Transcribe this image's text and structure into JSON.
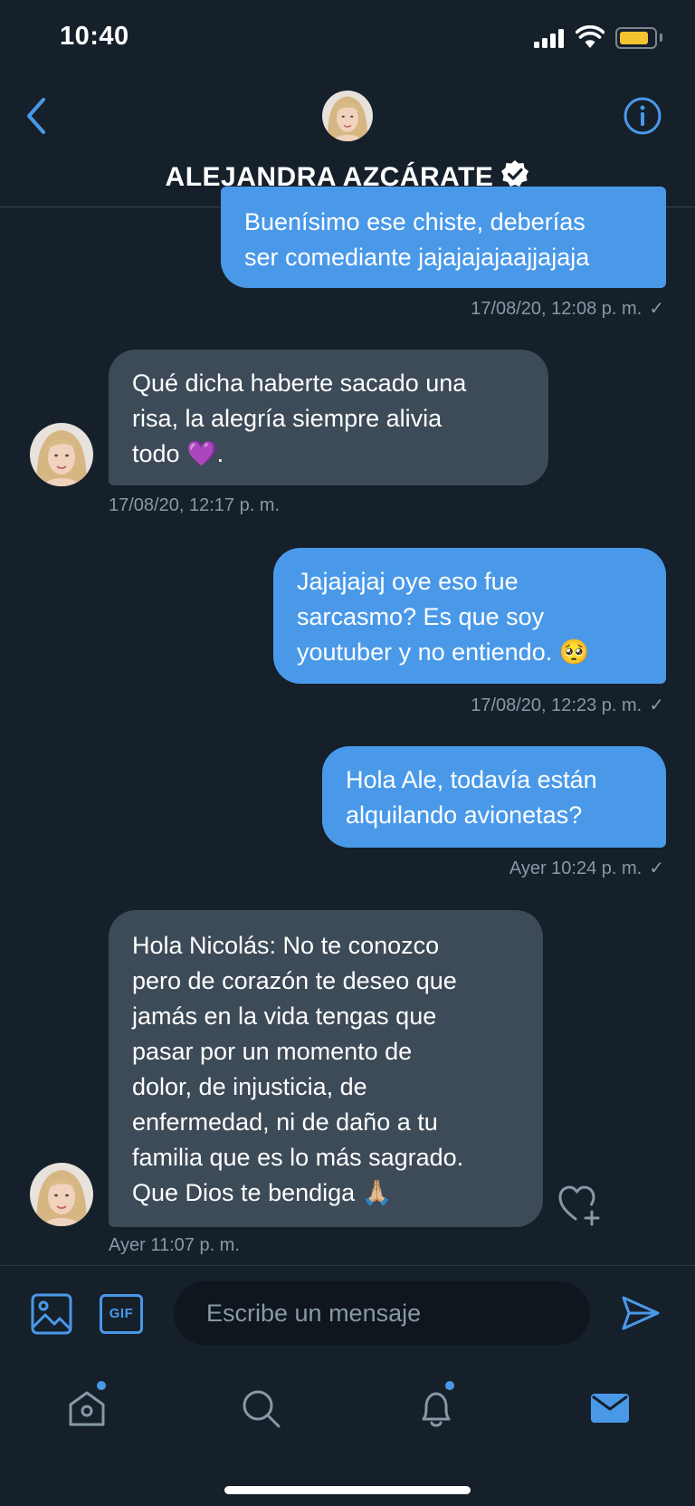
{
  "status_bar": {
    "time": "10:40"
  },
  "header": {
    "name": "ALEJANDRA AZCÁRATE"
  },
  "messages": [
    {
      "type": "sent",
      "lines": [
        "Buenísimo ese chiste, deberías",
        "ser comediante jajajajajaajjajaja"
      ],
      "time": "17/08/20, 12:08 p. m.",
      "status": "✓"
    },
    {
      "type": "received",
      "lines": [
        "Qué dicha haberte sacado una",
        "risa, la alegría siempre alivia",
        "todo 💜."
      ],
      "time": "17/08/20, 12:17 p. m."
    },
    {
      "type": "sent",
      "lines": [
        "Jajajajaj oye eso fue",
        "sarcasmo? Es que soy",
        "youtuber y no entiendo. 🥺"
      ],
      "time": "17/08/20, 12:23 p. m.",
      "status": "✓"
    },
    {
      "type": "sent",
      "lines": [
        "Hola Ale, todavía están",
        "alquilando avionetas?"
      ],
      "time": "Ayer 10:24 p. m.",
      "status": "✓"
    },
    {
      "type": "received",
      "lines": [
        "Hola Nicolás: No te conozco",
        "pero de corazón te deseo que",
        "jamás en la vida tengas que",
        "pasar por un momento de",
        "dolor, de injusticia, de",
        "enfermedad, ni de daño a tu",
        "familia que es lo más sagrado.",
        "Que Dios te bendiga 🙏🏼"
      ],
      "time": "Ayer 11:07 p. m."
    }
  ],
  "composer": {
    "gif_label": "GIF",
    "placeholder": "Escribe un mensaje"
  },
  "icons": {
    "back": "chevron-left-icon",
    "info": "info-icon",
    "verified": "verified-badge-icon",
    "image": "image-icon",
    "send": "send-icon",
    "heart_add": "heart-plus-icon",
    "tabs": [
      "home-icon",
      "search-icon",
      "bell-icon",
      "mail-icon"
    ]
  },
  "colors": {
    "background": "#15202b",
    "accent": "#4a99e9",
    "received_bubble": "#3d4a57",
    "muted_text": "#8899a6"
  }
}
